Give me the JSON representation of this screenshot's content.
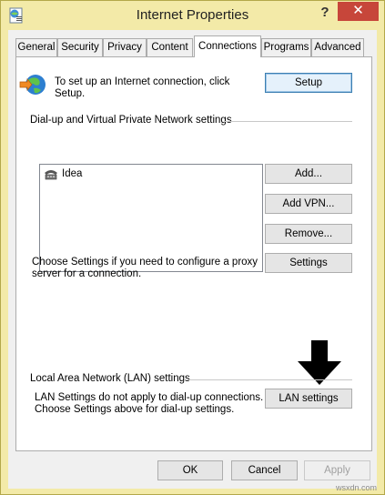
{
  "window": {
    "title": "Internet Properties",
    "help_label": "?",
    "close_label": "✕"
  },
  "tabs": [
    {
      "label": "General",
      "active": false
    },
    {
      "label": "Security",
      "active": false
    },
    {
      "label": "Privacy",
      "active": false
    },
    {
      "label": "Content",
      "active": false
    },
    {
      "label": "Connections",
      "active": true
    },
    {
      "label": "Programs",
      "active": false
    },
    {
      "label": "Advanced",
      "active": false
    }
  ],
  "setup_section": {
    "description_line1": "To set up an Internet connection, click",
    "description_line2": "Setup.",
    "setup_button": "Setup"
  },
  "dialup_section": {
    "heading": "Dial-up and Virtual Private Network settings",
    "connections": [
      {
        "name": "Idea",
        "icon": "dialup-connection-icon"
      }
    ],
    "add_button": "Add...",
    "add_vpn_button": "Add VPN...",
    "remove_button": "Remove...",
    "proxy_text_line1": "Choose Settings if you need to configure a proxy",
    "proxy_text_line2": "server for a connection.",
    "settings_button": "Settings"
  },
  "lan_section": {
    "heading": "Local Area Network (LAN) settings",
    "note_line1": "LAN Settings do not apply to dial-up connections.",
    "note_line2": "Choose Settings above for dial-up settings.",
    "lan_settings_button": "LAN settings"
  },
  "footer": {
    "ok_button": "OK",
    "cancel_button": "Cancel",
    "apply_button": "Apply"
  },
  "watermark": "wsxdn.com",
  "colors": {
    "frame": "#f3eaa8",
    "close_button": "#c7463a",
    "focus_border": "#3c7fb1"
  }
}
